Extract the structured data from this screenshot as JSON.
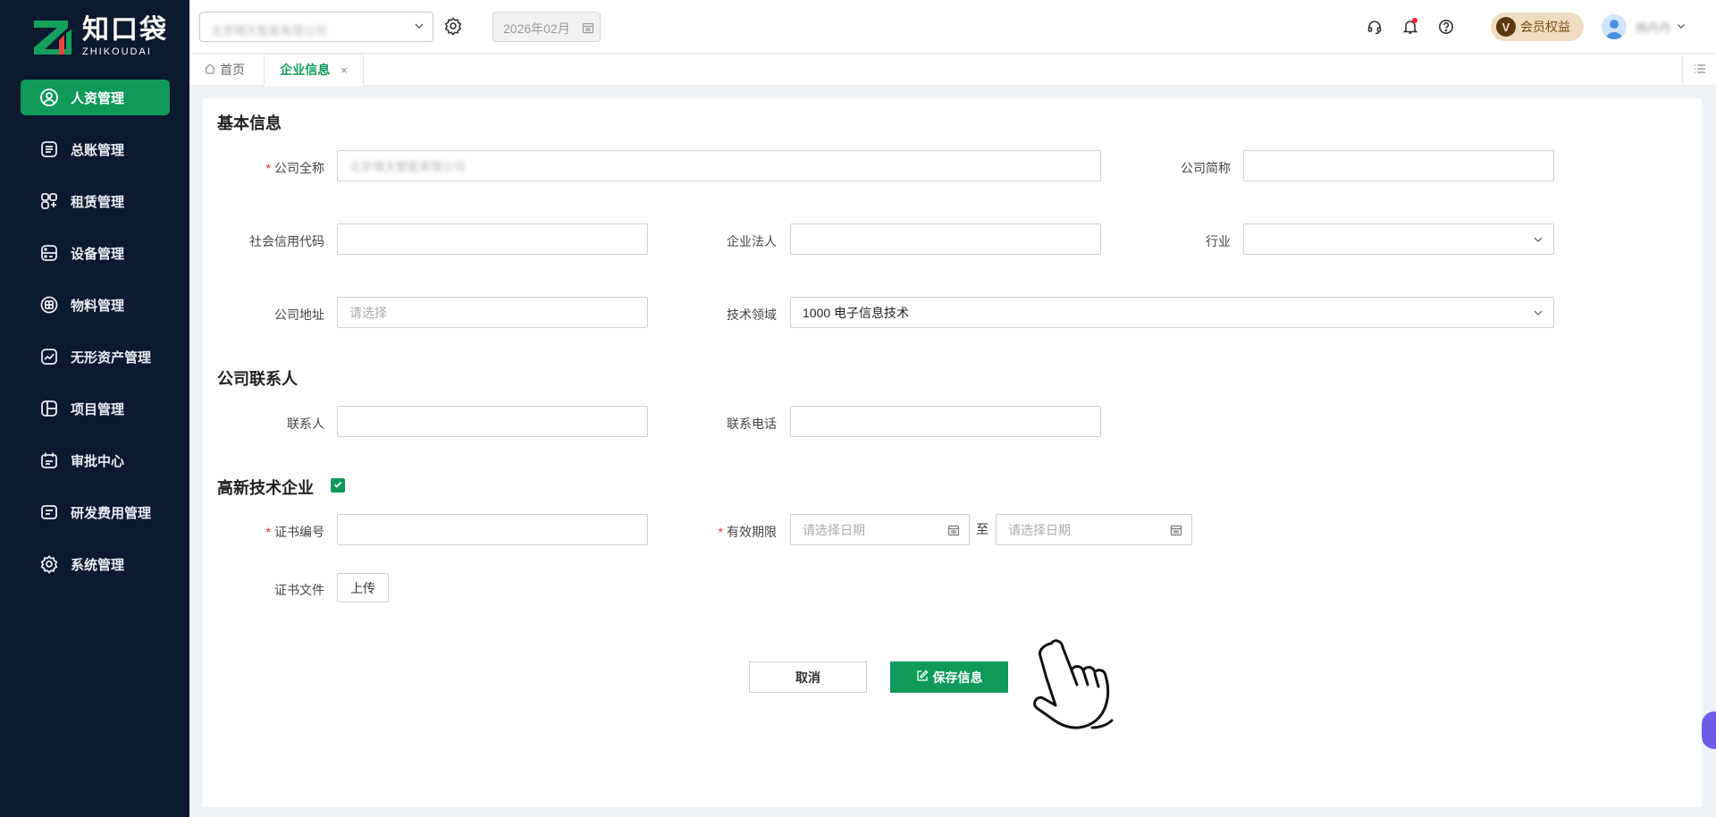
{
  "brand": {
    "name_cn": "知口袋",
    "name_en": "ZHIKOUDAI"
  },
  "sidebar": {
    "items": [
      {
        "label": "人资管理",
        "icon": "user-circle-icon",
        "active": true
      },
      {
        "label": "总账管理",
        "icon": "ledger-icon"
      },
      {
        "label": "租赁管理",
        "icon": "lease-icon"
      },
      {
        "label": "设备管理",
        "icon": "device-icon"
      },
      {
        "label": "物料管理",
        "icon": "box-icon"
      },
      {
        "label": "无形资产管理",
        "icon": "chart-doc-icon"
      },
      {
        "label": "项目管理",
        "icon": "project-icon"
      },
      {
        "label": "审批中心",
        "icon": "calendar-check-icon"
      },
      {
        "label": "研发费用管理",
        "icon": "list-card-icon"
      },
      {
        "label": "系统管理",
        "icon": "gear-icon"
      }
    ]
  },
  "header": {
    "company_value": "北京晴天智能有限公司",
    "month_value": "2026年02月",
    "vip_badge": "V",
    "vip_label": "会员权益",
    "user_name": "杨丹丹"
  },
  "tabs": {
    "home_label": "首页",
    "active_label": "企业信息",
    "close_symbol": "×"
  },
  "form": {
    "basic_section": "基本信息",
    "company_full_name_label": "公司全称",
    "company_full_name_value": "北京晴天智能有限公司",
    "company_short_name_label": "公司简称",
    "credit_code_label": "社会信用代码",
    "legal_person_label": "企业法人",
    "industry_label": "行业",
    "address_label": "公司地址",
    "address_placeholder": "请选择",
    "tech_field_label": "技术领域",
    "tech_field_value": "1000 电子信息技术",
    "contact_section": "公司联系人",
    "contact_person_label": "联系人",
    "contact_phone_label": "联系电话",
    "hitech_section": "高新技术企业",
    "hitech_checked": true,
    "cert_no_label": "证书编号",
    "validity_label": "有效期限",
    "date_placeholder": "请选择日期",
    "to_label": "至",
    "cert_file_label": "证书文件",
    "upload_label": "上传"
  },
  "actions": {
    "cancel_label": "取消",
    "save_label": "保存信息"
  },
  "colors": {
    "primary": "#0f9a5a",
    "sidebar_bg": "#0b1a2e",
    "required": "#f5222d"
  }
}
